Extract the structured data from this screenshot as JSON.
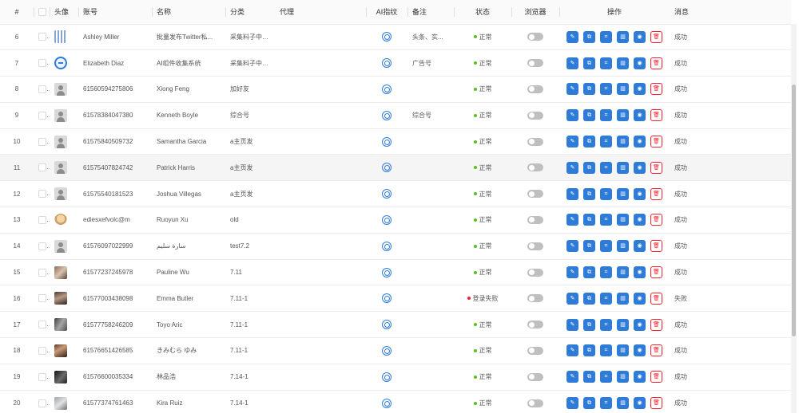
{
  "header": {
    "index": "#",
    "avatar": "头像",
    "account": "账号",
    "name": "名称",
    "group": "分类",
    "proxy": "代理",
    "ai_fingerprint": "AI指纹",
    "remark": "备注",
    "status": "状态",
    "browser": "浏览器",
    "actions": "操作",
    "message": "消息"
  },
  "rows": [
    {
      "index": "6",
      "avatar": "qr",
      "account": "Ashley Miller",
      "name": "批量发布Twitter私...",
      "group": "采集料子中心...",
      "remark": "头条、实...",
      "status": "正常",
      "status_color": "#52c41a",
      "message": "成功",
      "highlight": false
    },
    {
      "index": "7",
      "avatar": "circle",
      "account": "Elizabeth Diaz",
      "name": "AI组件收集系统",
      "group": "采集料子中心...",
      "remark": "广告号",
      "status": "正常",
      "status_color": "#52c41a",
      "message": "成功",
      "highlight": false
    },
    {
      "index": "8",
      "avatar": "default",
      "account": "61560594275806",
      "name": "Xiong Feng",
      "group": "加好友",
      "remark": "",
      "status": "正常",
      "status_color": "#52c41a",
      "message": "成功",
      "highlight": false
    },
    {
      "index": "9",
      "avatar": "default",
      "account": "61578384047380",
      "name": "Kenneth Boyle",
      "group": "综合号",
      "remark": "综合号",
      "status": "正常",
      "status_color": "#52c41a",
      "message": "成功",
      "highlight": false
    },
    {
      "index": "10",
      "avatar": "default",
      "account": "61575840509732",
      "name": "Samantha Garcia",
      "group": "a主页发",
      "remark": "",
      "status": "正常",
      "status_color": "#52c41a",
      "message": "成功",
      "highlight": false
    },
    {
      "index": "11",
      "avatar": "default",
      "account": "61575407824742",
      "name": "Patrick Harris",
      "group": "a主页发",
      "remark": "",
      "status": "正常",
      "status_color": "#52c41a",
      "message": "成功",
      "highlight": true
    },
    {
      "index": "12",
      "avatar": "default",
      "account": "61575540181523",
      "name": "Joshua Villegas",
      "group": "a主页发",
      "remark": "",
      "status": "正常",
      "status_color": "#52c41a",
      "message": "成功",
      "highlight": false
    },
    {
      "index": "13",
      "avatar": "cartoon",
      "account": "ediesxefvolc@m",
      "name": "Ruoyun Xu",
      "group": "old",
      "remark": "",
      "status": "正常",
      "status_color": "#52c41a",
      "message": "成功",
      "highlight": false
    },
    {
      "index": "14",
      "avatar": "default",
      "account": "61576097022999",
      "name": "سارة سليم",
      "group": "test7.2",
      "remark": "",
      "status": "正常",
      "status_color": "#52c41a",
      "message": "成功",
      "highlight": false
    },
    {
      "index": "15",
      "avatar": "photo1",
      "account": "61577237245978",
      "name": "Pauline Wu",
      "group": "7.11",
      "remark": "",
      "status": "正常",
      "status_color": "#52c41a",
      "message": "成功",
      "highlight": false
    },
    {
      "index": "16",
      "avatar": "photo2",
      "account": "61577003438098",
      "name": "Emma Butler",
      "group": "7.11-1",
      "remark": "",
      "status": "登录失败",
      "status_color": "#f5222d",
      "message": "失败",
      "highlight": false
    },
    {
      "index": "17",
      "avatar": "photo3",
      "account": "61577758246209",
      "name": "Toyo Aric",
      "group": "7.11-1",
      "remark": "",
      "status": "正常",
      "status_color": "#52c41a",
      "message": "成功",
      "highlight": false
    },
    {
      "index": "18",
      "avatar": "photo4",
      "account": "61576651426585",
      "name": "きみむら ゆみ",
      "group": "7.11-1",
      "remark": "",
      "status": "正常",
      "status_color": "#52c41a",
      "message": "成功",
      "highlight": false
    },
    {
      "index": "19",
      "avatar": "photo5",
      "account": "61576600035334",
      "name": "林品浩",
      "group": "7.14-1",
      "remark": "",
      "status": "正常",
      "status_color": "#52c41a",
      "message": "成功",
      "highlight": false
    },
    {
      "index": "20",
      "avatar": "photo6",
      "account": "61577374761463",
      "name": "Kira Ruiz",
      "group": "7.14-1",
      "remark": "",
      "status": "正常",
      "status_color": "#52c41a",
      "message": "成功",
      "highlight": false
    }
  ],
  "actions": [
    {
      "icon": "edit-icon",
      "glyph": "✎"
    },
    {
      "icon": "copy-icon",
      "glyph": "⧉"
    },
    {
      "icon": "scan-icon",
      "glyph": "⌗"
    },
    {
      "icon": "chart-icon",
      "glyph": "▥"
    },
    {
      "icon": "view-icon",
      "glyph": "◉"
    },
    {
      "icon": "delete-icon",
      "glyph": "🗑"
    }
  ],
  "colors": {
    "accent": "#2f7bd8",
    "danger": "#f5222d",
    "success": "#52c41a"
  }
}
